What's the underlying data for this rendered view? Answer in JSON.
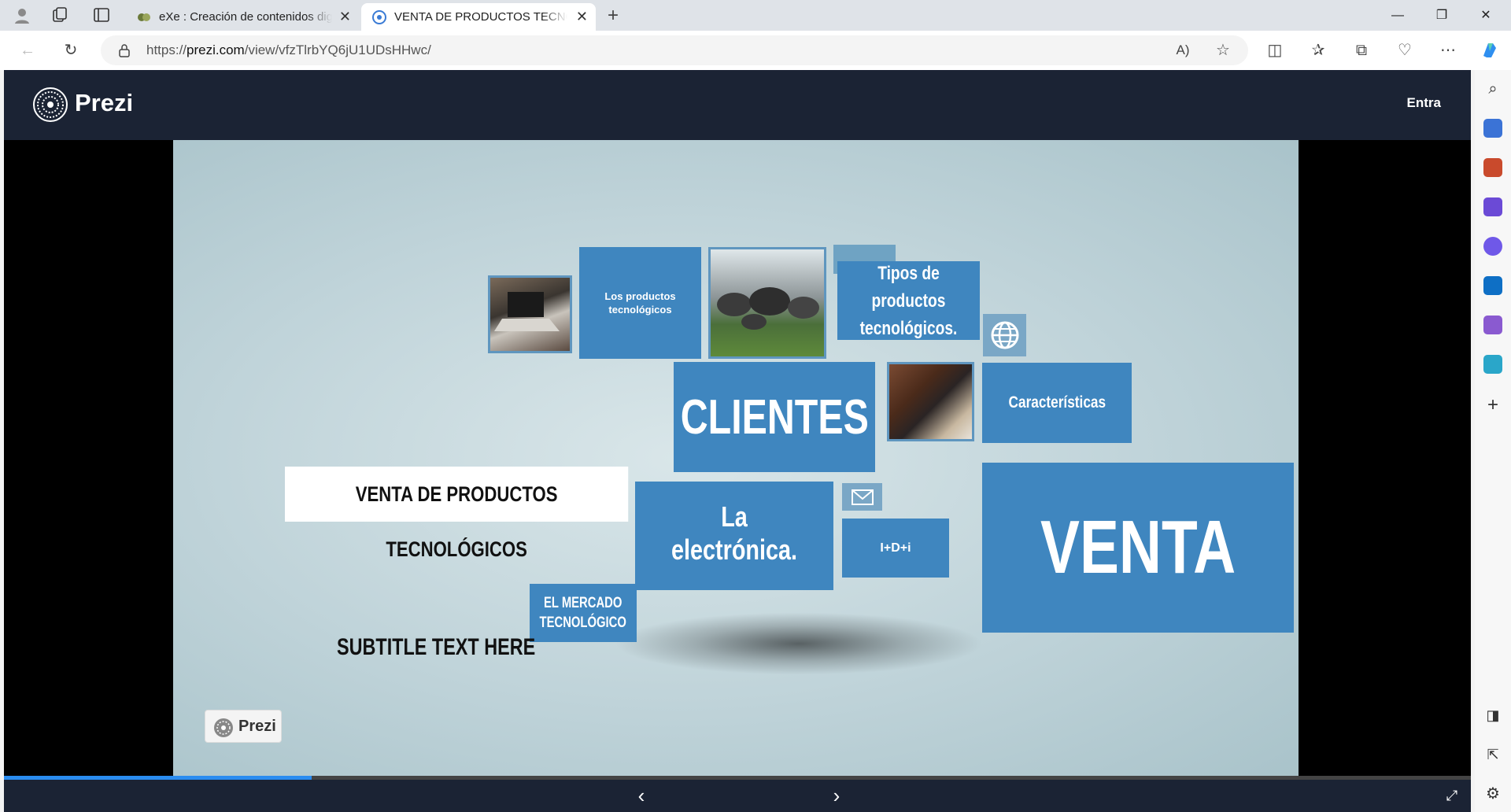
{
  "browser": {
    "tabs": [
      {
        "title": "eXe : Creación de contenidos dig",
        "active": false
      },
      {
        "title": "VENTA DE PRODUCTOS TECNOL",
        "active": true
      }
    ],
    "url_prefix": "https://",
    "url_domain": "prezi.com",
    "url_path": "/view/vfzTlrbYQ6jU1UDsHHwc/",
    "icons": {
      "profile": "profile-icon",
      "workspaces": "workspaces-icon",
      "tab_actions": "tab-actions-icon",
      "back": "back-arrow-icon",
      "refresh": "refresh-icon",
      "lock": "lock-icon",
      "read_aloud": "read-aloud-icon",
      "favorite": "star-icon",
      "split": "split-screen-icon",
      "favorites": "favorites-icon",
      "collections": "collections-icon",
      "health": "browser-essentials-icon",
      "more": "more-icon",
      "copilot": "copilot-icon"
    }
  },
  "prezi": {
    "brand": "Prezi",
    "login_label": "Entra",
    "presentation": {
      "title": "VENTA DE PRODUCTOS TECNOLÓGICOS",
      "subtitle": "SUBTITLE TEXT HERE",
      "tiles": {
        "productos": "Los productos tecnológicos",
        "tipos": "Tipos de productos tecnológicos.",
        "clientes": "CLIENTES",
        "caracteristicas": "Características",
        "electronica": "La electrónica.",
        "idi": "I+D+i",
        "venta": "VENTA",
        "mercado": "EL MERCADO TECNOLÓGICO"
      },
      "watermark": "Prezi"
    },
    "progress_fraction": 0.21
  },
  "colors": {
    "tile_blue": "#3f86bf",
    "prezi_header": "#1b2334",
    "progress": "#2a8cf0"
  }
}
